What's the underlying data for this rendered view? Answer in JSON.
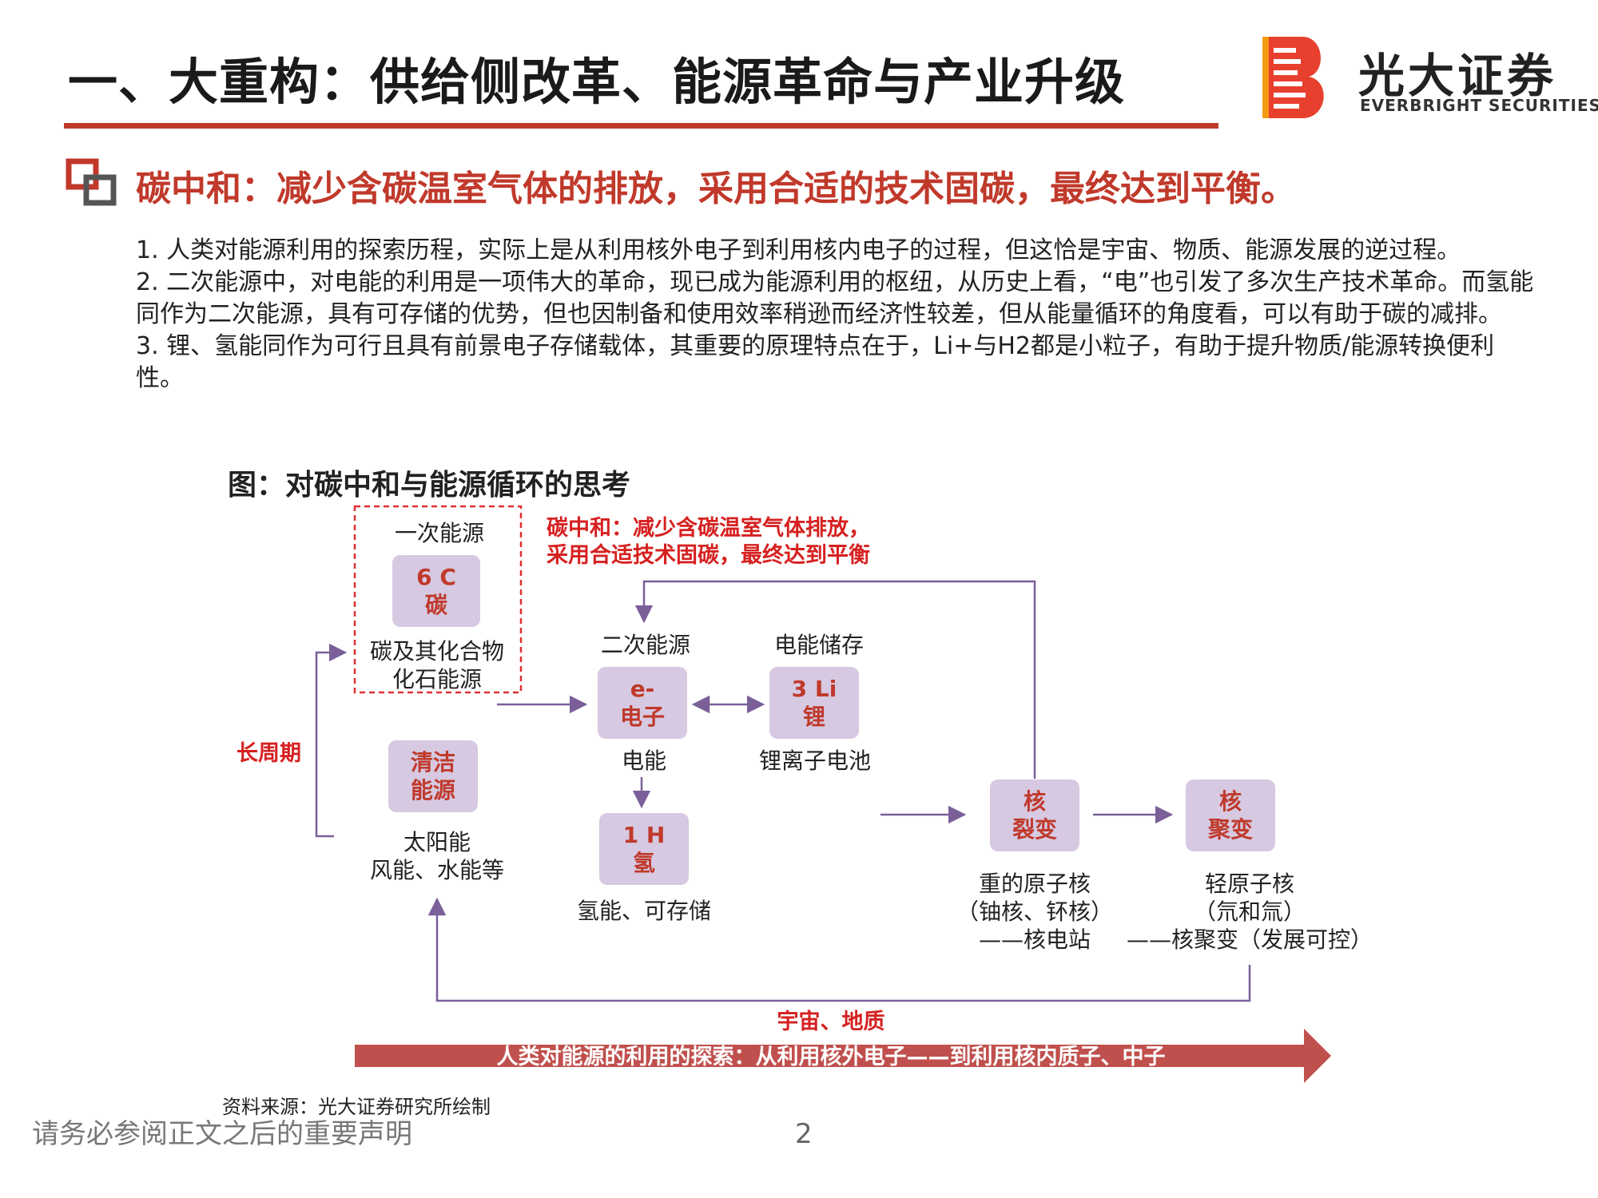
{
  "header": {
    "title": "一、大重构：供给侧改革、能源革命与产业升级",
    "logo_cn": "光大证券",
    "logo_en": "EVERBRIGHT SECURITIES"
  },
  "subtitle": "碳中和：减少含碳温室气体的排放，采用合适的技术固碳，最终达到平衡。",
  "body": {
    "p1": "1. 人类对能源利用的探索历程，实际上是从利用核外电子到利用核内电子的过程，但这恰是宇宙、物质、能源发展的逆过程。",
    "p2": "2. 二次能源中，对电能的利用是一项伟大的革命，现已成为能源利用的枢纽，从历史上看，“电”也引发了多次生产技术革命。而氢能同作为二次能源，具有可存储的优势，但也因制备和使用效率稍逊而经济性较差，但从能量循环的角度看，可以有助于碳的减排。",
    "p3": "3. 锂、氢能同作为可行且具有前景电子存储载体，其重要的原理特点在于，Li+与H2都是小粒子，有助于提升物质/能源转换便利性。"
  },
  "figure": {
    "caption": "图：对碳中和与能源循环的思考",
    "red_note_line1": "碳中和：减少含碳温室气体排放，",
    "red_note_line2": "采用合适技术固碳，最终达到平衡",
    "primary_label": "一次能源",
    "carbon_box_line1": "6 C",
    "carbon_box_line2": "碳",
    "carbon_desc_line1": "碳及其化合物",
    "carbon_desc_line2": "化石能源",
    "long_cycle": "长周期",
    "clean_box_line1": "清洁",
    "clean_box_line2": "能源",
    "clean_desc_line1": "太阳能",
    "clean_desc_line2": "风能、水能等",
    "secondary_label": "二次能源",
    "electron_box_line1": "e-",
    "electron_box_line2": "电子",
    "electron_desc": "电能",
    "storage_label": "电能储存",
    "lithium_box_line1": "3 Li",
    "lithium_box_line2": "锂",
    "lithium_desc": "锂离子电池",
    "hydrogen_box_line1": "1 H",
    "hydrogen_box_line2": "氢",
    "hydrogen_desc": "氢能、可存储",
    "fission_box_line1": "核",
    "fission_box_line2": "裂变",
    "fission_desc_line1": "重的原子核",
    "fission_desc_line2": "（铀核、钚核）",
    "fission_desc_line3": "——核电站",
    "fusion_box_line1": "核",
    "fusion_box_line2": "聚变",
    "fusion_desc_line1": "轻原子核",
    "fusion_desc_line2": "（氘和氚）",
    "fusion_desc_line3": "——核聚变（发展可控）",
    "universe_label": "宇宙、地质",
    "bottom_arrow_text": "人类对能源的利用的探索：从利用核外电子——到利用核内质子、中子",
    "source": "资料来源：光大证券研究所绘制"
  },
  "footer": {
    "disclaimer": "请务必参阅正文之后的重要声明",
    "page": "2"
  },
  "colors": {
    "brand_red": "#c0392b",
    "box_fill": "#d6c9e1",
    "connector": "#7a5f99",
    "bottom_arrow": "#c0504d"
  }
}
